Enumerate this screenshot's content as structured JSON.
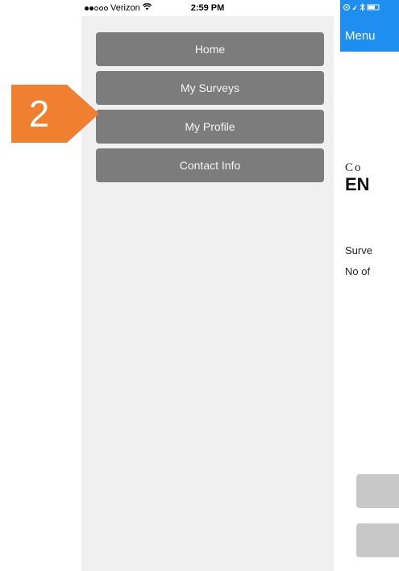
{
  "status_bar": {
    "carrier": "Verizon",
    "time": "2:59 PM",
    "wifi_icon": "wifi-icon"
  },
  "menu": {
    "items": [
      {
        "label": "Home"
      },
      {
        "label": "My Surveys"
      },
      {
        "label": "My Profile"
      },
      {
        "label": "Contact Info"
      }
    ]
  },
  "annotation": {
    "number": "2",
    "color": "#f0802f"
  },
  "right_screen": {
    "nav_label": "Menu",
    "brand_line1": "Co",
    "brand_line2": "EN",
    "info_line1": "Surve",
    "info_line2": "No of",
    "accent": "#1f8ef1"
  },
  "colors": {
    "menu_button": "#7c7c7c",
    "panel_bg": "#f0f0f0"
  }
}
